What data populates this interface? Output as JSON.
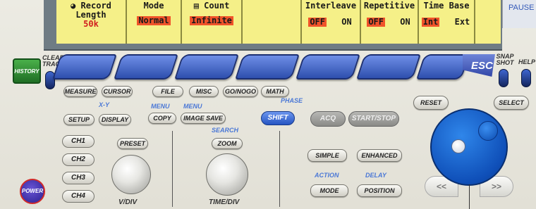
{
  "screen_menu": [
    {
      "id": "record-length",
      "header": "Record",
      "header2": "Length",
      "value": "50k",
      "icon": "record-icon"
    },
    {
      "id": "mode",
      "header": "Mode",
      "value": "Normal"
    },
    {
      "id": "count",
      "header": "Count",
      "value": "Infinite",
      "icon": "count-icon"
    },
    {
      "id": "blank",
      "header": "",
      "value": ""
    },
    {
      "id": "interleave",
      "header": "Interleave",
      "opt_off": "OFF",
      "opt_on": "ON",
      "selected": "OFF"
    },
    {
      "id": "repetitive",
      "header": "Repetitive",
      "opt_off": "OFF",
      "opt_on": "ON",
      "selected": "OFF"
    },
    {
      "id": "time-base",
      "header": "Time Base",
      "opt_off": "Int",
      "opt_on": "Ext",
      "selected": "Int"
    }
  ],
  "pause_label": "PAUSE",
  "left": {
    "history": "HISTORY",
    "clear_trace": "CLEAR",
    "clear_trace2": "TRACE",
    "power": "POWER"
  },
  "right_top": {
    "esc": "ESC",
    "snapshot": "SNAP",
    "snapshot2": "SHOT",
    "help": "HELP"
  },
  "pills": {
    "measure": "MEASURE",
    "cursor": "CURSOR",
    "file": "FILE",
    "misc": "MISC",
    "go_nogo": "GO/NOGO",
    "math": "MATH",
    "setup": "SETUP",
    "display": "DISPLAY",
    "copy": "COPY",
    "image_save": "IMAGE SAVE",
    "preset": "PRESET",
    "zoom": "ZOOM",
    "simple": "SIMPLE",
    "enhanced": "ENHANCED",
    "mode": "MODE",
    "position": "POSITION",
    "reset": "RESET",
    "select": "SELECT"
  },
  "labels": {
    "xy": "X-Y",
    "menu1": "MENU",
    "menu2": "MENU",
    "phase": "PHASE",
    "search": "SEARCH",
    "action": "ACTION",
    "delay": "DELAY",
    "vdiv": "V/DIV",
    "timediv": "TIME/DIV"
  },
  "shift": "SHIFT",
  "acq": "ACQ",
  "start_stop": "START/STOP",
  "channels": [
    "CH1",
    "CH2",
    "CH3",
    "CH4"
  ],
  "jog_left": "<<",
  "jog_right": ">>"
}
